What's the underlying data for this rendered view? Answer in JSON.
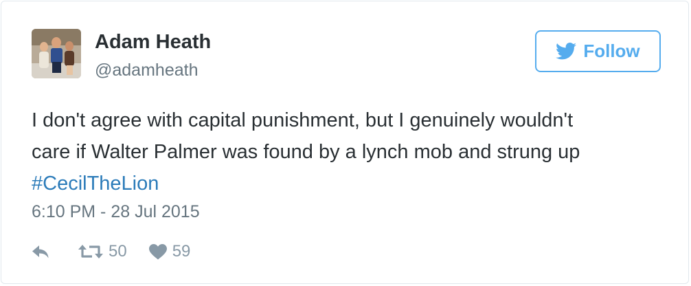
{
  "user": {
    "name": "Adam Heath",
    "handle": "@adamheath"
  },
  "follow": {
    "label": "Follow",
    "icon": "twitter-bird-icon",
    "color": "#55acee"
  },
  "tweet": {
    "lines": [
      "I don't agree with capital punishment, but I genuinely wouldn't",
      "care if Walter Palmer was found by a lynch mob and strung up"
    ],
    "hashtag": "#CecilTheLion",
    "hashtag_color": "#2b7bb9",
    "timestamp": "6:10 PM - 28 Jul 2015"
  },
  "actions": {
    "reply": {
      "icon": "reply-icon"
    },
    "retweet": {
      "icon": "retweet-icon",
      "count": "50"
    },
    "like": {
      "icon": "heart-icon",
      "count": "59"
    }
  },
  "colors": {
    "text": "#292f33",
    "secondary": "#66757f",
    "action": "#8899a6",
    "border": "#e1e8ed"
  }
}
